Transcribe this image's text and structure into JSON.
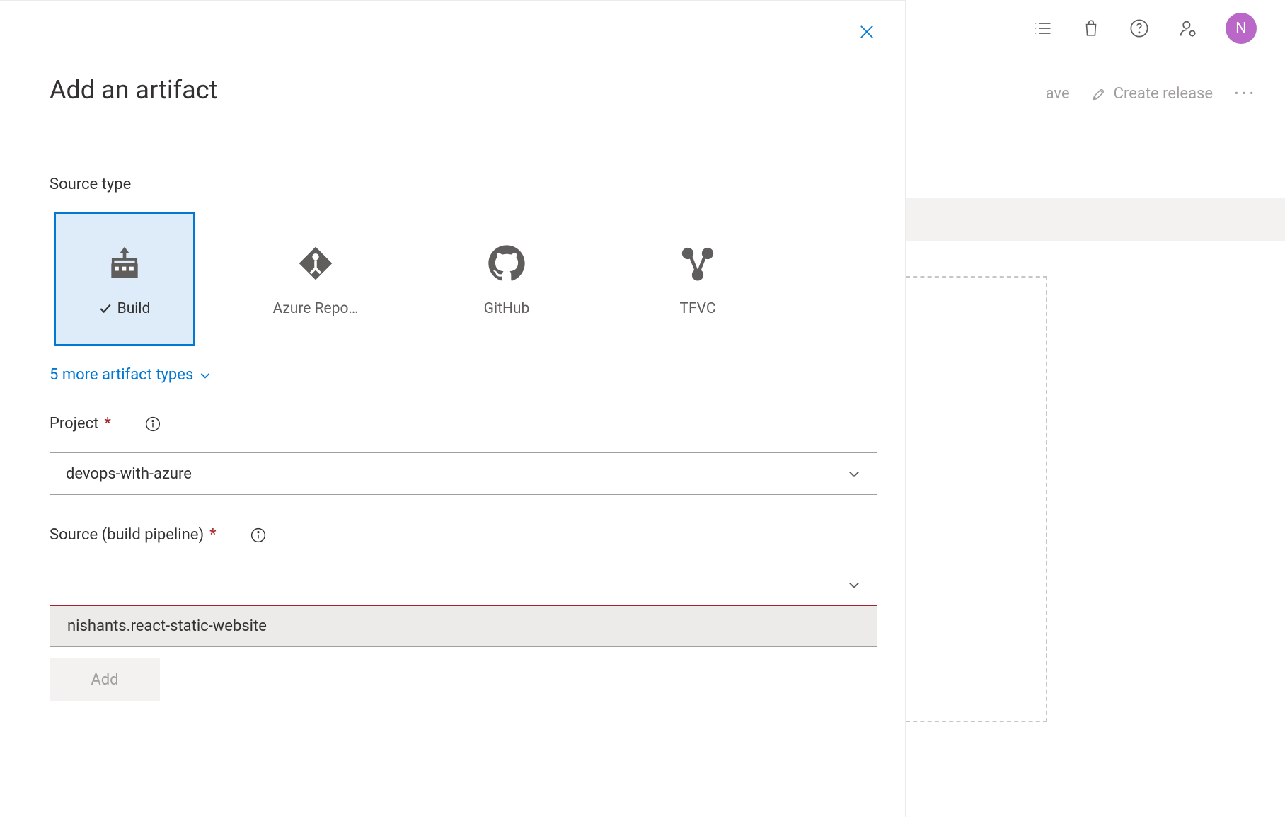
{
  "topbar": {
    "avatar_initial": "N"
  },
  "actions": {
    "save_label": "ave",
    "create_release_label": "Create release"
  },
  "panel": {
    "title": "Add an artifact",
    "source_type_label": "Source type",
    "source_types": [
      {
        "label": "Build",
        "selected": true
      },
      {
        "label": "Azure Repo…",
        "selected": false
      },
      {
        "label": "GitHub",
        "selected": false
      },
      {
        "label": "TFVC",
        "selected": false
      }
    ],
    "more_types_label": "5 more artifact types",
    "project": {
      "label": "Project",
      "value": "devops-with-azure"
    },
    "source_pipeline": {
      "label": "Source (build pipeline)",
      "value": "",
      "options": [
        "nishants.react-static-website"
      ]
    },
    "add_button_label": "Add"
  }
}
